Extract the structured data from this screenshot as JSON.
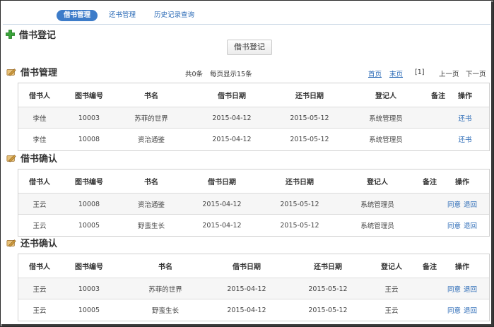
{
  "tabs": [
    {
      "label": "借书管理",
      "active": true
    },
    {
      "label": "还书管理",
      "active": false
    },
    {
      "label": "历史记录查询",
      "active": false
    }
  ],
  "sections": {
    "register_title": "借书登记",
    "register_button": "借书登记",
    "manage_title": "借书管理",
    "confirm_borrow_title": "借书确认",
    "confirm_return_title": "还书确认"
  },
  "pagination": {
    "summary": "共0条",
    "per_page": "每页显示15条",
    "first": "首页",
    "last": "末页",
    "current": "[1]",
    "prev": "上一页",
    "next": "下一页"
  },
  "columns": [
    "借书人",
    "图书编号",
    "书名",
    "借书日期",
    "还书日期",
    "登记人",
    "备注",
    "操作"
  ],
  "manage_rows": [
    {
      "borrower": "李佳",
      "book_id": "10003",
      "title": "苏菲的世界",
      "borrow_date": "2015-04-12",
      "return_date": "2015-05-12",
      "registrar": "系统管理员",
      "note": "",
      "actions": [
        "还书"
      ]
    },
    {
      "borrower": "李佳",
      "book_id": "10008",
      "title": "资治通鉴",
      "borrow_date": "2015-04-12",
      "return_date": "2015-05-12",
      "registrar": "系统管理员",
      "note": "",
      "actions": [
        "还书"
      ]
    }
  ],
  "borrow_confirm_rows": [
    {
      "borrower": "王云",
      "book_id": "10008",
      "title": "资治通鉴",
      "borrow_date": "2015-04-12",
      "return_date": "2015-05-12",
      "registrar": "系统管理员",
      "note": "",
      "actions": [
        "同意",
        "退回"
      ]
    },
    {
      "borrower": "王云",
      "book_id": "10005",
      "title": "野蛮生长",
      "borrow_date": "2015-04-12",
      "return_date": "2015-05-12",
      "registrar": "系统管理员",
      "note": "",
      "actions": [
        "同意",
        "退回"
      ]
    }
  ],
  "return_confirm_rows": [
    {
      "borrower": "王云",
      "book_id": "10003",
      "title": "苏菲的世界",
      "borrow_date": "2015-04-12",
      "return_date": "2015-05-12",
      "registrar": "王云",
      "note": "",
      "actions": [
        "同意",
        "退回"
      ]
    },
    {
      "borrower": "王云",
      "book_id": "10005",
      "title": "野蛮生长",
      "borrow_date": "2015-04-12",
      "return_date": "2015-05-12",
      "registrar": "王云",
      "note": "",
      "actions": [
        "同意",
        "退回"
      ]
    }
  ],
  "colors": {
    "accent": "#3d7cc9",
    "link": "#2a6ab6",
    "plus_icon": "#3aa33a"
  },
  "icons": {
    "register": "plus-icon",
    "manage": "pencil-icon",
    "confirm_borrow": "pencil-icon",
    "confirm_return": "pencil-icon"
  }
}
